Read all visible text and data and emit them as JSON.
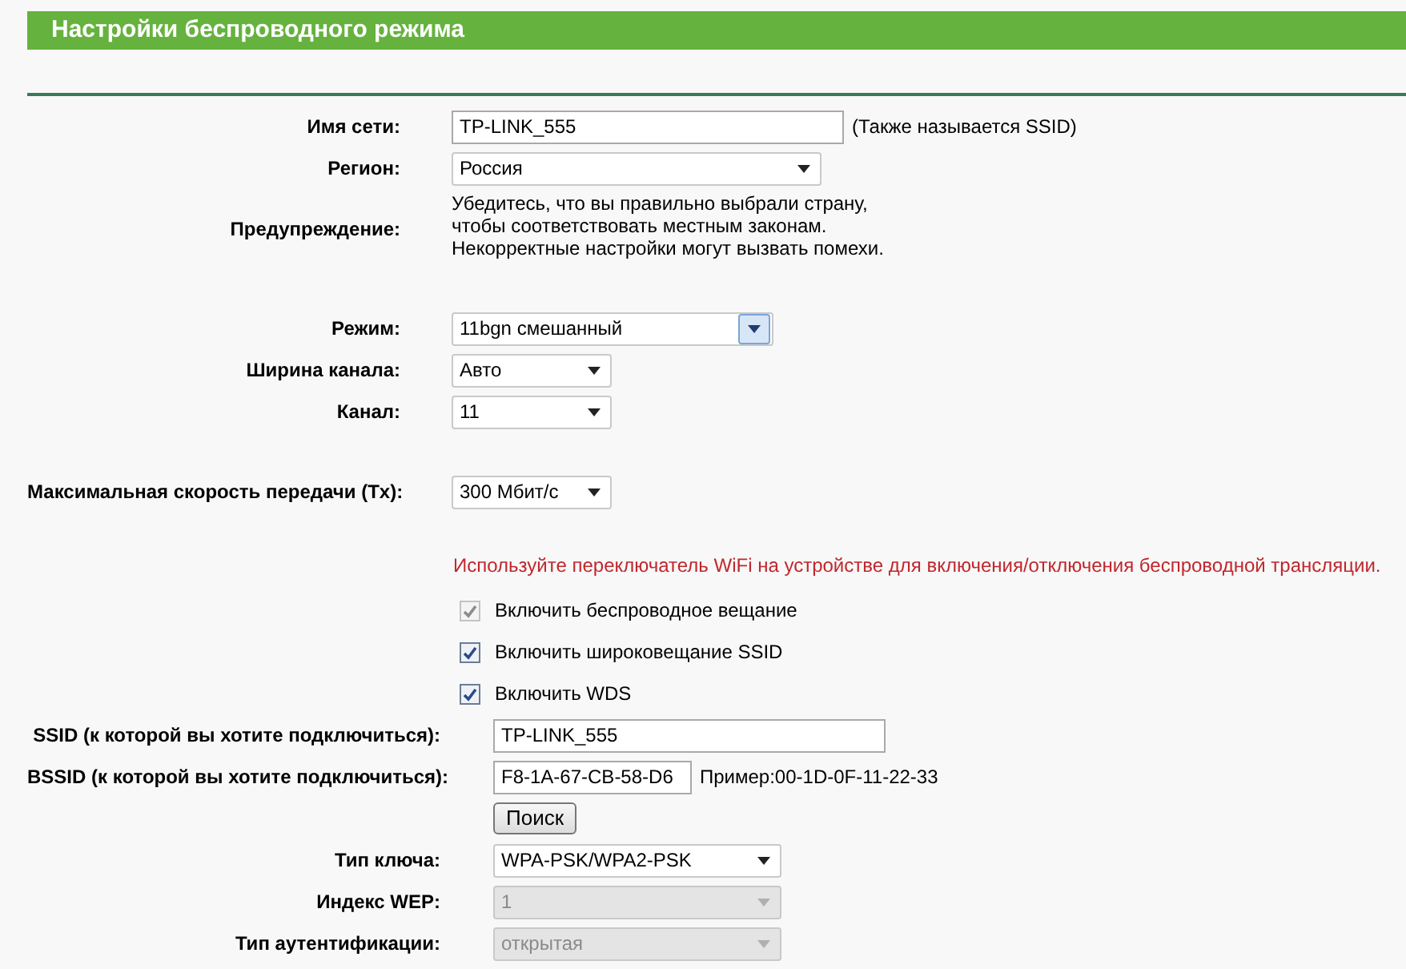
{
  "header": {
    "title": "Настройки беспроводного режима"
  },
  "groups": [
    [
      {
        "kind": "input",
        "label": "Имя сети:",
        "value": "TP-LINK_555",
        "note": "(Также называется SSID)"
      },
      {
        "kind": "select",
        "label": "Регион:",
        "value": "Россия",
        "focused": false,
        "disabled": false
      },
      {
        "kind": "text",
        "label": "Предупреждение:",
        "lines": [
          "Убедитесь, что вы правильно выбрали страну,",
          "чтобы соответствовать местным законам.",
          "Некорректные настройки могут вызвать помехи."
        ]
      }
    ],
    [
      {
        "kind": "select",
        "label": "Режим:",
        "value": "11bgn смешанный",
        "focused": true,
        "disabled": false
      },
      {
        "kind": "select",
        "label": "Ширина канала:",
        "value": "Авто",
        "focused": false,
        "disabled": false
      },
      {
        "kind": "select",
        "label": "Канал:",
        "value": "11",
        "focused": false,
        "disabled": false
      }
    ],
    [
      {
        "kind": "select",
        "label": "Максимальная скорость передачи (Tx):",
        "value": "300 Мбит/с",
        "focused": false,
        "disabled": false
      }
    ]
  ],
  "notice": "Используйте переключатель WiFi на устройстве для включения/отключения беспроводной трансляции.",
  "checkboxes": [
    {
      "label": "Включить беспроводное вещание",
      "checked": true,
      "disabled": true
    },
    {
      "label": "Включить широковещание SSID",
      "checked": true,
      "disabled": false
    },
    {
      "label": "Включить WDS",
      "checked": true,
      "disabled": false
    }
  ],
  "wds_rows": [
    {
      "kind": "input",
      "label": "SSID (к которой вы хотите подключиться):",
      "value": "TP-LINK_555"
    },
    {
      "kind": "input",
      "label": "BSSID (к которой вы хотите подключиться):",
      "value": "F8-1A-67-CB-58-D6",
      "note": "Пример:00-1D-0F-11-22-33"
    },
    {
      "kind": "button",
      "text": "Поиск"
    },
    {
      "kind": "select",
      "label": "Тип ключа:",
      "value": "WPA-PSK/WPA2-PSK",
      "focused": false,
      "disabled": false
    },
    {
      "kind": "select",
      "label": "Индекс WEP:",
      "value": "1",
      "focused": false,
      "disabled": true
    },
    {
      "kind": "select",
      "label": "Тип аутентификации:",
      "value": "открытая",
      "focused": false,
      "disabled": true
    }
  ]
}
